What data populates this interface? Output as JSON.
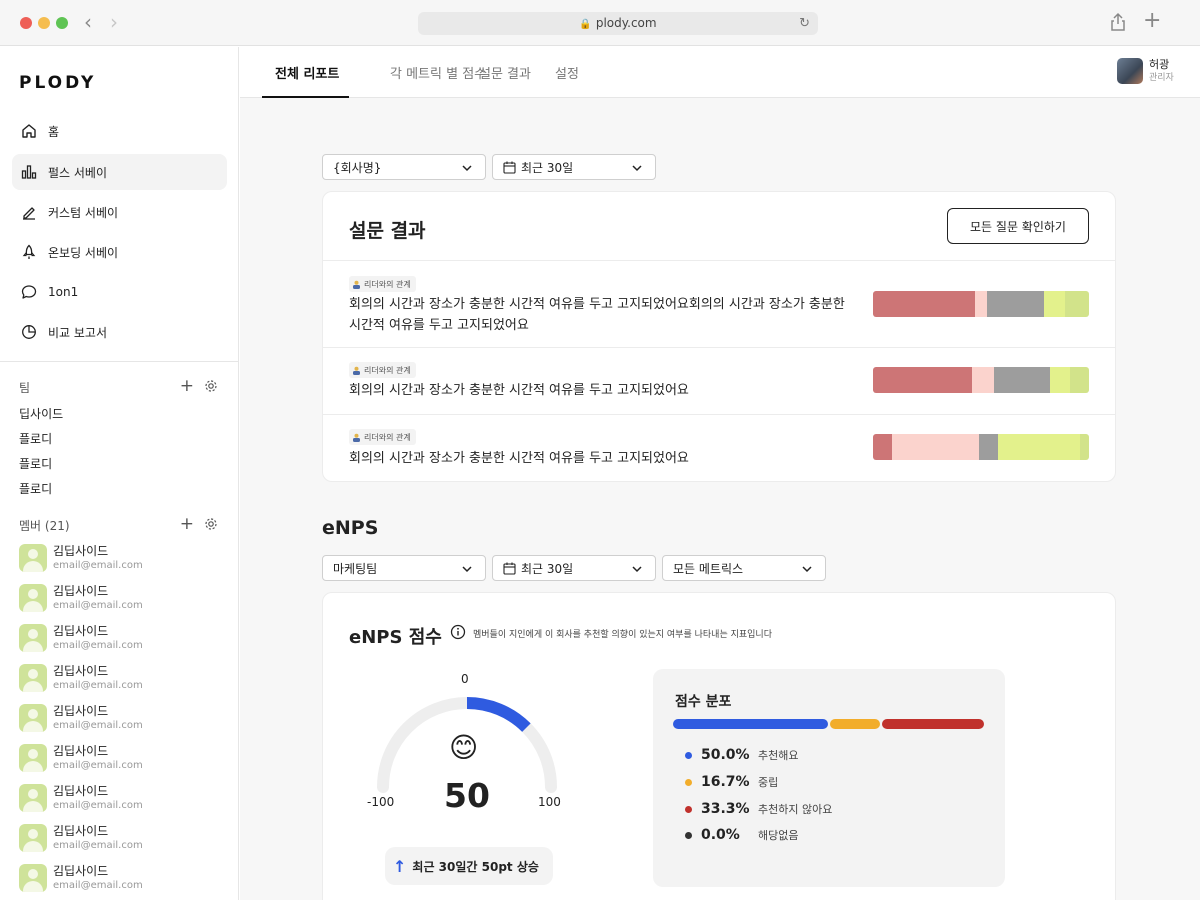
{
  "browser": {
    "url": "plody.com"
  },
  "sidebar": {
    "logo": "PLODY",
    "nav": [
      {
        "label": "홈",
        "icon": "home-icon"
      },
      {
        "label": "펄스 서베이",
        "icon": "bar-chart-icon",
        "active": true
      },
      {
        "label": "커스텀 서베이",
        "icon": "pencil-icon"
      },
      {
        "label": "온보딩 서베이",
        "icon": "rocket-icon"
      },
      {
        "label": "1on1",
        "icon": "chat-bubble-icon"
      },
      {
        "label": "비교 보고서",
        "icon": "pie-chart-icon"
      }
    ],
    "teams_title": "팀",
    "teams": [
      "딥사이드",
      "플로디",
      "플로디",
      "플로디"
    ],
    "members_title": "멤버 (21)",
    "members": [
      {
        "name": "김딥사이드",
        "email": "email@email.com"
      },
      {
        "name": "김딥사이드",
        "email": "email@email.com"
      },
      {
        "name": "김딥사이드",
        "email": "email@email.com"
      },
      {
        "name": "김딥사이드",
        "email": "email@email.com"
      },
      {
        "name": "김딥사이드",
        "email": "email@email.com"
      },
      {
        "name": "김딥사이드",
        "email": "email@email.com"
      },
      {
        "name": "김딥사이드",
        "email": "email@email.com"
      },
      {
        "name": "김딥사이드",
        "email": "email@email.com"
      },
      {
        "name": "김딥사이드",
        "email": "email@email.com"
      }
    ]
  },
  "header": {
    "tabs": [
      {
        "label": "전체 리포트",
        "active": true
      },
      {
        "label": "각 메트릭 별 점수"
      },
      {
        "label": "설문 결과"
      },
      {
        "label": "설정"
      }
    ],
    "user": {
      "name": "허광",
      "role": "관리자"
    }
  },
  "filters_top": {
    "company": "{회사명}",
    "period": "최근 30일"
  },
  "survey": {
    "title": "설문 결과",
    "button": "모든 질문 확인하기",
    "rows": [
      {
        "tag": "리더와의 관계",
        "question": "회의의 시간과 장소가 충분한 시간적 여유를 두고 고지되었어요회의의 시간과 장소가 충분한 시간적 여유를 두고 고지되었어요",
        "segments": [
          47,
          6,
          26,
          10,
          11
        ]
      },
      {
        "tag": "리더와의 관계",
        "question": "회의의 시간과 장소가 충분한 시간적 여유를 두고 고지되었어요",
        "segments": [
          46,
          10,
          26,
          9,
          9
        ]
      },
      {
        "tag": "리더와의 관계",
        "question": "회의의 시간과 장소가 충분한 시간적 여유를 두고 고지되었어요",
        "segments": [
          9,
          40,
          9,
          38,
          4
        ]
      }
    ],
    "segment_colors": [
      "#cd7576",
      "#fbd3cd",
      "#9d9d9d",
      "#e3f18c",
      "#d2e38a"
    ]
  },
  "enps_section": {
    "title": "eNPS",
    "filters": {
      "team": "마케팅팀",
      "period": "최근 30일",
      "metric": "모든 메트릭스"
    }
  },
  "enps_card": {
    "title": "eNPS 점수",
    "info": "멤버들이 지인에게 이 회사를 추천할 의향이 있는지 여부를 나타내는 지표입니다",
    "gauge": {
      "min": "-100",
      "mid": "0",
      "max": "100",
      "value": 50
    },
    "emoji": "😊",
    "score": "50",
    "trend": "최근 30일간 50pt 상승",
    "distribution": {
      "title": "점수 분포",
      "items": [
        {
          "percent": "50.0%",
          "label": "추천해요",
          "value": 50.0,
          "color": "#2f5be0"
        },
        {
          "percent": "16.7%",
          "label": "중립",
          "value": 16.7,
          "color": "#f2ad2b"
        },
        {
          "percent": "33.3%",
          "label": "추천하지 않아요",
          "value": 33.3,
          "color": "#c0312c"
        },
        {
          "percent": "0.0%",
          "label": "해당없음",
          "value": 0.0,
          "color": "#333333"
        }
      ]
    }
  }
}
